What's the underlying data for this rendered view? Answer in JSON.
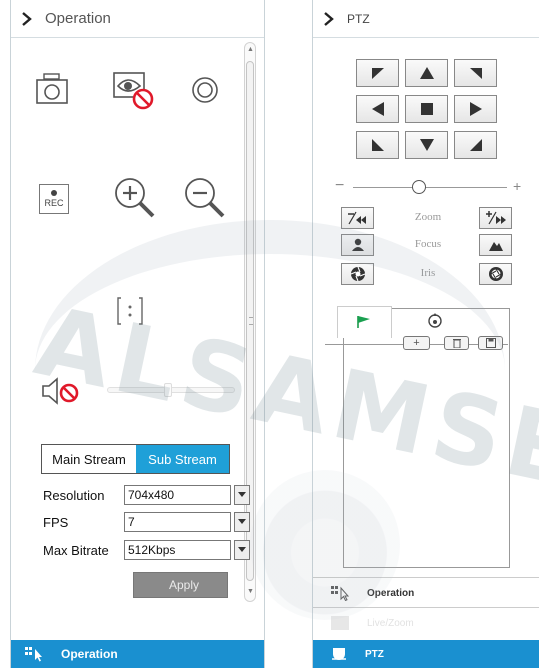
{
  "watermark": {
    "text": "ALSAMSECUR"
  },
  "left_panel": {
    "header": {
      "title": "Operation"
    },
    "tools": {
      "snapshot_icon": "camera-icon",
      "video_off_icon": "eye-blocked-icon",
      "record_icon": "record-circle-icon",
      "rec_label": "REC",
      "zoom_in_icon": "magnifier-plus-icon",
      "zoom_out_icon": "magnifier-minus-icon",
      "ratio_icon": "aspect-ratio-icon",
      "mute_icon": "speaker-mute-icon",
      "volume_level": 0.47
    },
    "stream": {
      "tabs": [
        "Main Stream",
        "Sub Stream"
      ],
      "active_tab": "Sub Stream",
      "active_color": "#1fa0d8"
    },
    "settings": {
      "resolution_label": "Resolution",
      "resolution_value": "704x480",
      "fps_label": "FPS",
      "fps_value": "7",
      "bitrate_label": "Max Bitrate",
      "bitrate_value": "512Kbps"
    },
    "apply_label": "Apply",
    "footer": {
      "label": "Operation",
      "color": "#1a90d0"
    }
  },
  "right_panel": {
    "header": {
      "title": "PTZ"
    },
    "controls": {
      "zoom_label": "Zoom",
      "focus_label": "Focus",
      "iris_label": "Iris",
      "zoom_level": 0.43
    },
    "preset": {
      "tabs": [
        "preset-flag-icon",
        "cruise-icon"
      ],
      "buttons": [
        "+",
        "delete-icon",
        "save-icon"
      ]
    },
    "nav": {
      "operation_label": "Operation",
      "hidden_label": "Live/Zoom",
      "ptz_label": "PTZ",
      "active_color": "#1a90d0"
    }
  }
}
